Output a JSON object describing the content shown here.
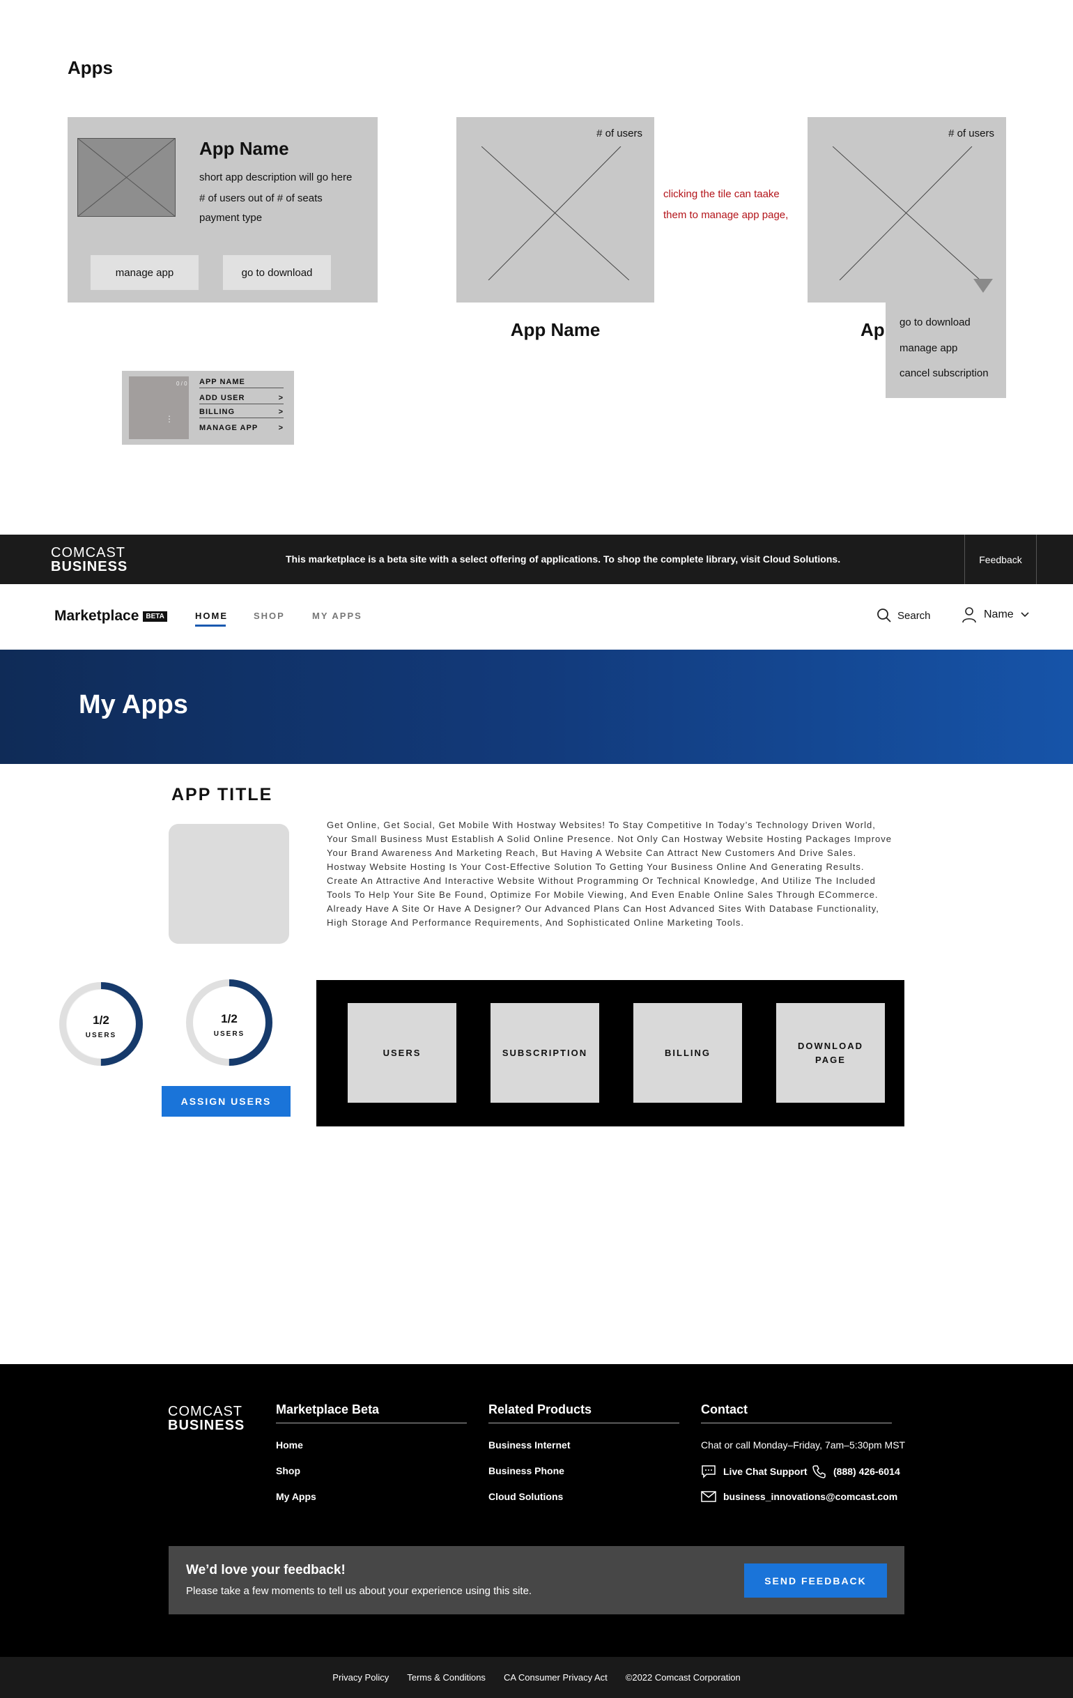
{
  "wireframe": {
    "heading": "Apps",
    "card1": {
      "name": "App Name",
      "description": "short app description will go here",
      "users": "# of users out of # of seats",
      "payment": "payment type",
      "manage_label": "manage app",
      "download_label": "go to download"
    },
    "card2": {
      "users": "# of users",
      "name": "App Name"
    },
    "note": {
      "line1": "clicking the tile can taake",
      "line2": "them to manage app page,"
    },
    "card3": {
      "users": "# of users",
      "name_partial": "Ap",
      "dropdown": [
        "go to download",
        "manage app",
        "cancel subscription"
      ]
    },
    "mini_card": {
      "badge": "0 / 0",
      "rows": [
        {
          "label": "APP NAME",
          "arrow": ""
        },
        {
          "label": "ADD USER",
          "arrow": ">"
        },
        {
          "label": "BILLING",
          "arrow": ">"
        },
        {
          "label": "MANAGE APP",
          "arrow": ">"
        }
      ]
    }
  },
  "beta_bar": {
    "logo_line1": "COMCAST",
    "logo_line2": "BUSINESS",
    "message": "This marketplace is a beta site with a select offering of applications. To shop the complete library, visit Cloud Solutions.",
    "feedback": "Feedback"
  },
  "nav": {
    "brand": "Marketplace",
    "badge": "BETA",
    "links": [
      "HOME",
      "SHOP",
      "MY APPS"
    ],
    "active": "HOME",
    "search": "Search",
    "user": "Name"
  },
  "hero": {
    "title": "My Apps"
  },
  "app": {
    "title": "APP TITLE",
    "description": "Get Online, Get Social, Get Mobile With Hostway Websites! To Stay Competitive In Today’s Technology Driven World, Your Small Business Must Establish A Solid Online Presence. Not Only Can Hostway Website Hosting Packages Improve Your Brand Awareness And Marketing Reach, But Having A Website Can Attract New Customers And Drive Sales. Hostway Website Hosting Is Your Cost-Effective Solution To Getting Your Business Online And Generating Results. Create An Attractive And Interactive Website Without Programming Or Technical Knowledge, And Utilize The Included Tools To Help Your Site Be Found, Optimize For Mobile Viewing, And Even Enable Online Sales Through ECommerce. Already Have A Site Or Have A Designer? Our Advanced Plans Can Host Advanced Sites With Database Functionality, High Storage And Performance Requirements, And Sophisticated Online Marketing Tools.",
    "donuts": [
      {
        "value": "1/2",
        "label": "USERS",
        "fraction": 0.5
      },
      {
        "value": "1/2",
        "label": "USERS",
        "fraction": 0.5
      }
    ],
    "assign_label": "ASSIGN USERS",
    "tiles": [
      {
        "line1": "USERS",
        "line2": ""
      },
      {
        "line1": "SUBSCRIPTION",
        "line2": ""
      },
      {
        "line1": "BILLING",
        "line2": ""
      },
      {
        "line1": "DOWNLOAD",
        "line2": "PAGE"
      }
    ]
  },
  "footer": {
    "logo_line1": "COMCAST",
    "logo_line2": "BUSINESS",
    "col1": {
      "title": "Marketplace Beta",
      "links": [
        "Home",
        "Shop",
        "My Apps"
      ]
    },
    "col2": {
      "title": "Related Products",
      "links": [
        "Business Internet",
        "Business Phone",
        "Cloud Solutions"
      ]
    },
    "col3": {
      "title": "Contact",
      "hours": "Chat or call Monday–Friday, 7am–5:30pm MST",
      "chat": "Live Chat Support",
      "phone": "(888) 426-6014",
      "email": "business_innovations@comcast.com"
    },
    "feedback": {
      "title": "We’d love your feedback!",
      "subtitle": "Please take a few moments to tell us about your experience using this site.",
      "button": "SEND FEEDBACK"
    },
    "legal": [
      "Privacy Policy",
      "Terms & Conditions",
      "CA Consumer Privacy Act",
      "©2022 Comcast Corporation"
    ]
  },
  "colors": {
    "accent_blue": "#1a74d9",
    "hero_start": "#0f2b57",
    "hero_end": "#1654a9",
    "donut_arc": "#163a6b",
    "note_red": "#b3141a"
  }
}
